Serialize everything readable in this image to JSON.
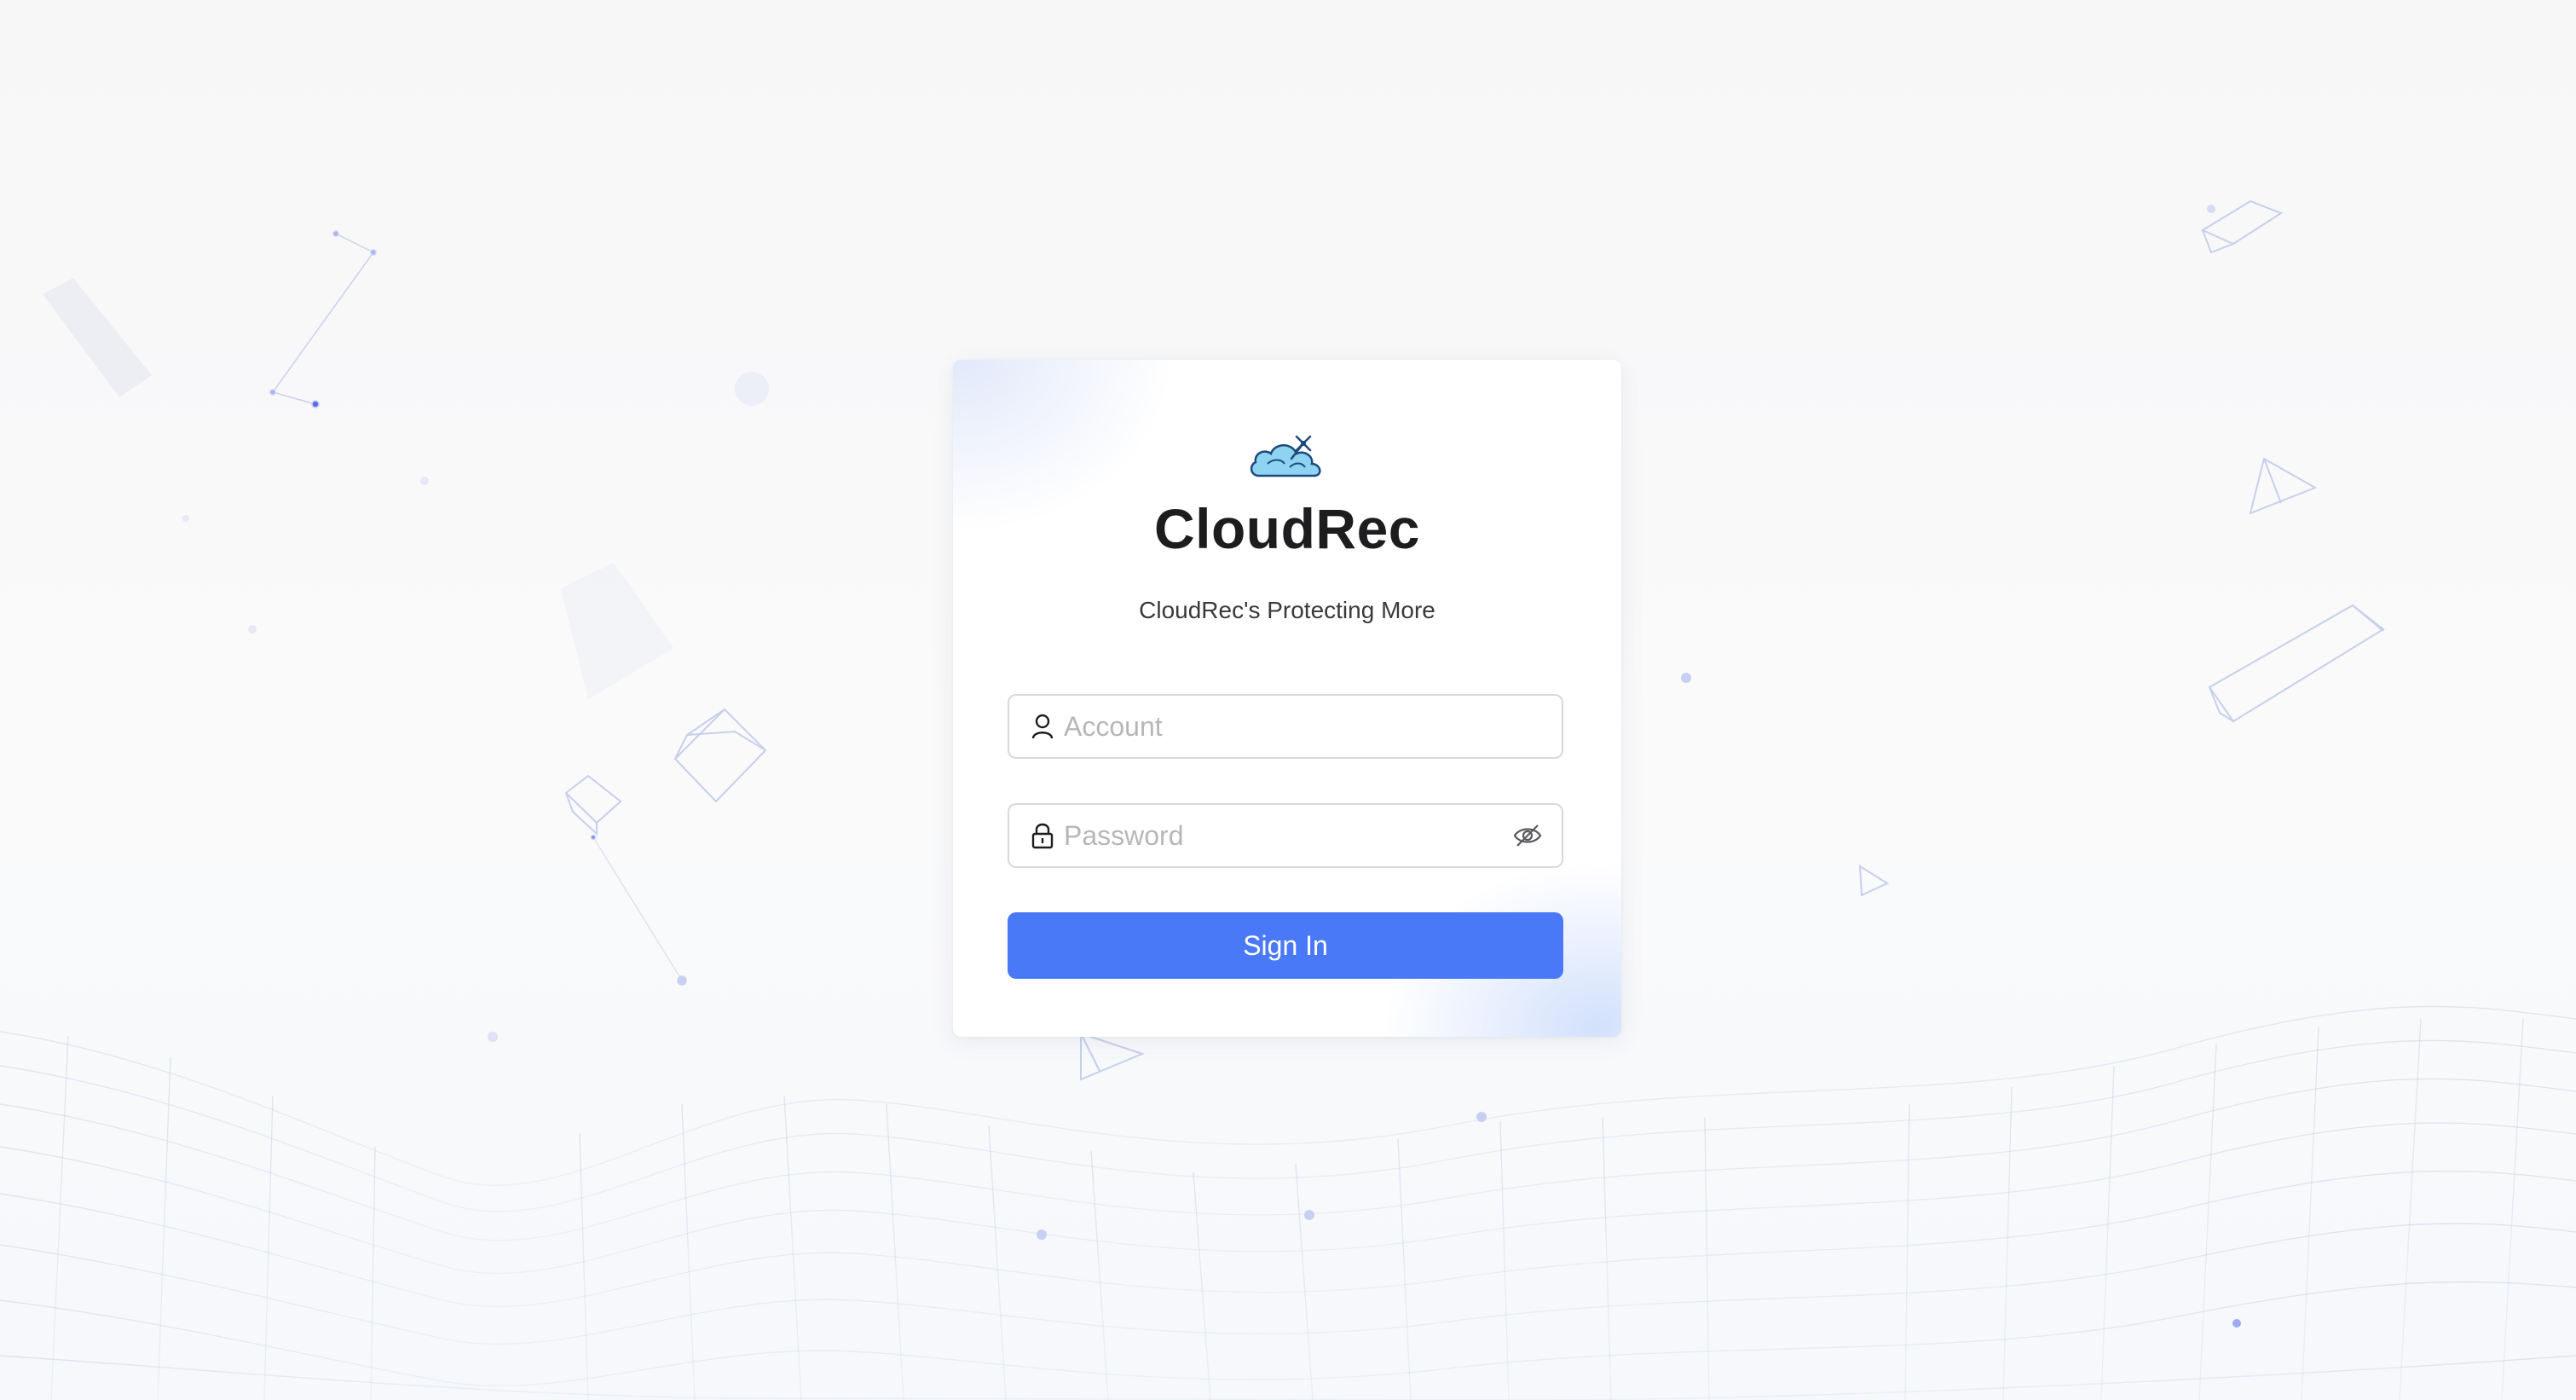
{
  "app": {
    "title": "CloudRec",
    "subtitle": "CloudRec's Protecting More"
  },
  "login": {
    "account": {
      "value": "",
      "placeholder": "Account",
      "icon": "user-icon"
    },
    "password": {
      "value": "",
      "placeholder": "Password",
      "icon": "lock-icon",
      "toggle_icon": "eye-invisible-icon"
    },
    "submit_label": "Sign In"
  },
  "colors": {
    "primary_button": "#4979f6",
    "background": "#f8f8f9",
    "card": "#ffffff",
    "logo_cloud": "#5bc0eb"
  }
}
